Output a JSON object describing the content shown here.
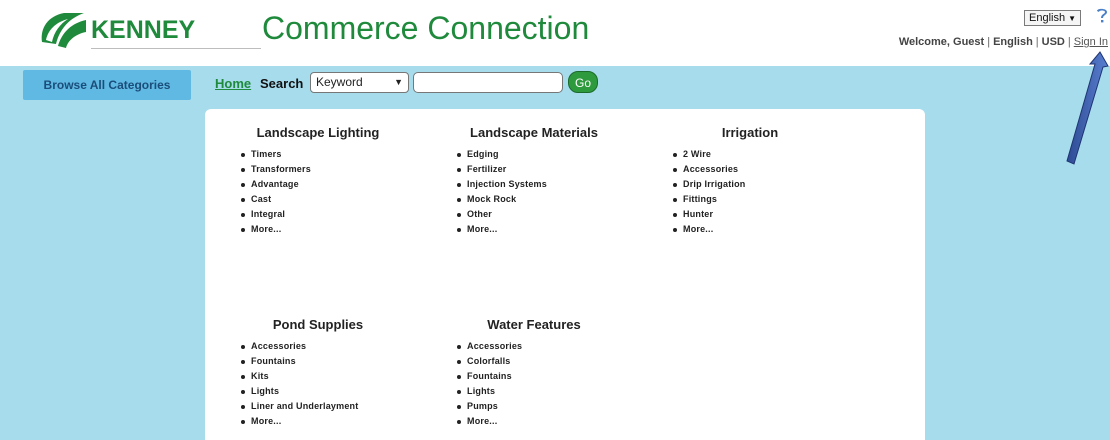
{
  "header": {
    "logo_text": "KENNEY",
    "site_title": "Commerce Connection",
    "language_selected": "English",
    "user_bar": {
      "welcome": "Welcome, Guest",
      "language": "English",
      "currency": "USD",
      "sign_in": "Sign In"
    }
  },
  "nav": {
    "browse_label": "Browse All Categories",
    "home_label": "Home",
    "search_label": "Search",
    "search_type_selected": "Keyword",
    "search_value": "",
    "go_label": "Go"
  },
  "categories": [
    {
      "title": "Landscape Lighting",
      "items": [
        "Timers",
        "Transformers",
        "Advantage",
        "Cast",
        "Integral",
        "More..."
      ]
    },
    {
      "title": "Landscape Materials",
      "items": [
        "Edging",
        "Fertilizer",
        "Injection Systems",
        "Mock Rock",
        "Other",
        "More..."
      ]
    },
    {
      "title": "Irrigation",
      "items": [
        "2 Wire",
        "Accessories",
        "Drip Irrigation",
        "Fittings",
        "Hunter",
        "More..."
      ]
    },
    {
      "title": "Pond Supplies",
      "items": [
        "Accessories",
        "Fountains",
        "Kits",
        "Lights",
        "Liner and Underlayment",
        "More..."
      ]
    },
    {
      "title": "Water Features",
      "items": [
        "Accessories",
        "Colorfalls",
        "Fountains",
        "Lights",
        "Pumps",
        "More..."
      ]
    }
  ],
  "colors": {
    "brand_green": "#1f8a3c",
    "main_background": "#a6dcec",
    "browse_button": "#5fb9e3",
    "go_button": "#2e9a3e",
    "annotation_arrow": "#3a5aa8"
  }
}
